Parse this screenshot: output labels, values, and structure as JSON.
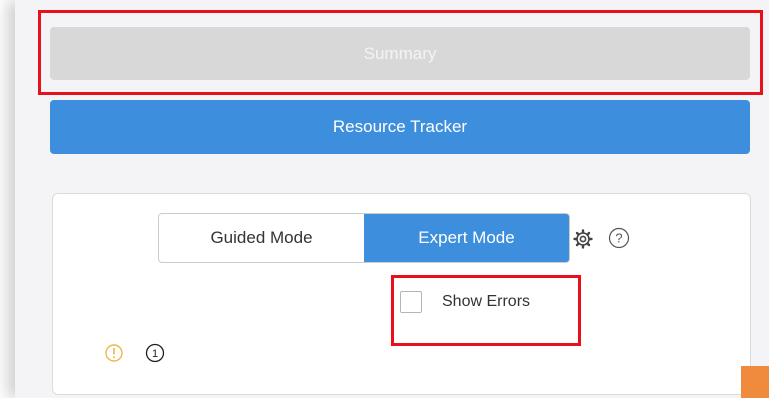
{
  "buttons": {
    "summary_label": "Summary",
    "resource_tracker_label": "Resource Tracker"
  },
  "mode_toggle": {
    "guided_label": "Guided Mode",
    "expert_label": "Expert Mode",
    "active": "Expert Mode"
  },
  "options": {
    "show_errors_label": "Show Errors",
    "show_errors_checked": false
  },
  "status": {
    "warning_icon": "info-circle-icon",
    "count_icon": "circled-one-icon",
    "count_value": "1"
  },
  "colors": {
    "accent": "#3d8fdd",
    "disabled": "#d8d8d8",
    "highlight": "#e8101a",
    "warning": "#f0b64a",
    "orange_tab": "#f08a3c"
  }
}
